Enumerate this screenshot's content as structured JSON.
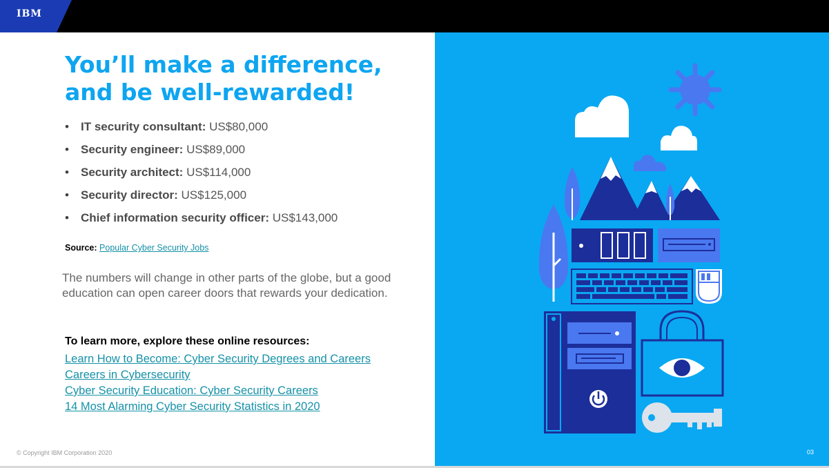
{
  "header": {
    "logo": "IBM"
  },
  "title": "You’ll make a difference, and be well-rewarded!",
  "salaries": [
    {
      "role": "IT security consultant:",
      "pay": "US$80,000"
    },
    {
      "role": "Security engineer:",
      "pay": "US$89,000"
    },
    {
      "role": "Security architect:",
      "pay": "US$114,000"
    },
    {
      "role": "Security director:",
      "pay": "US$125,000"
    },
    {
      "role": "Chief information security officer:",
      "pay": "US$143,000"
    }
  ],
  "source": {
    "label": "Source:",
    "link": "Popular Cyber Security Jobs"
  },
  "paragraph": "The numbers will change in other parts of the globe, but a good education can open career doors that rewards your dedication.",
  "learn_more": {
    "heading": "To learn more, explore these online resources:",
    "links": [
      "Learn How to Become: Cyber Security Degrees and Careers",
      "Careers in Cybersecurity",
      "Cyber Security Education: Cyber Security Careers",
      "14 Most Alarming Cyber Security Statistics in 2020"
    ]
  },
  "footer": {
    "copyright": "© Copyright IBM Corporation 2020",
    "page": "03"
  },
  "colors": {
    "accent": "#0ea5f0",
    "panel": "#0aa8f2",
    "navy": "#1c2e9a",
    "link": "#1591a8"
  }
}
